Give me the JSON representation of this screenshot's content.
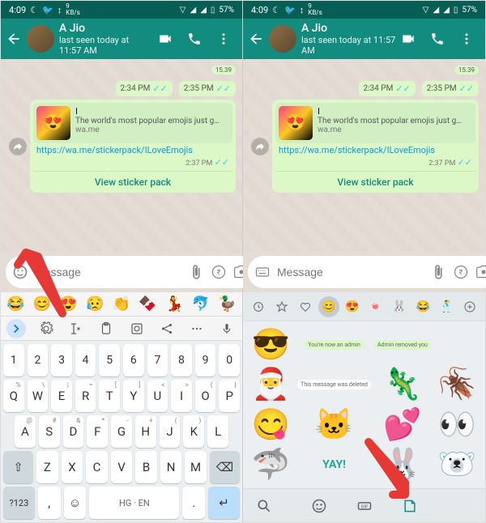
{
  "status": {
    "time": "4:09",
    "battery": "57%",
    "kbps": "9",
    "kbps_unit": "KB/s"
  },
  "header": {
    "name": "A Jio",
    "last_seen": "last seen today at 11:57 AM"
  },
  "chat": {
    "badge": "15.39",
    "time1": "2:34 PM",
    "time2": "2:35 PM",
    "preview_title": "I",
    "preview_desc": "The world's most popular emojis just g…",
    "preview_domain": "wa.me",
    "link": "https://wa.me/stickerpack/ILoveEmojis",
    "msg_time": "2:37 PM",
    "view_pack": "View sticker pack"
  },
  "input": {
    "placeholder": "Message"
  },
  "keyboard": {
    "nums": [
      "1",
      "2",
      "3",
      "4",
      "5",
      "6",
      "7",
      "8",
      "9",
      "0"
    ],
    "row1": [
      "Q",
      "W",
      "E",
      "R",
      "T",
      "Y",
      "U",
      "I",
      "O",
      "P"
    ],
    "row1sup": [
      "%",
      "\\",
      "|",
      "=",
      "[",
      "]",
      "<",
      ">",
      "{",
      "}"
    ],
    "row2": [
      "A",
      "S",
      "D",
      "F",
      "G",
      "H",
      "J",
      "K",
      "L"
    ],
    "row2sup": [
      "@",
      "#",
      "&",
      "*",
      "-",
      "+",
      "(",
      ")",
      ""
    ],
    "row3": [
      "Z",
      "X",
      "C",
      "V",
      "B",
      "N",
      "M"
    ],
    "sym": "?123",
    "lang": "HG · EN",
    "comma": ",",
    "period": "."
  },
  "stickers": {
    "chip1": "You're now an admin",
    "chip2": "Admin removed you",
    "chip3": "This message was deleted",
    "yay": "YAY!"
  }
}
